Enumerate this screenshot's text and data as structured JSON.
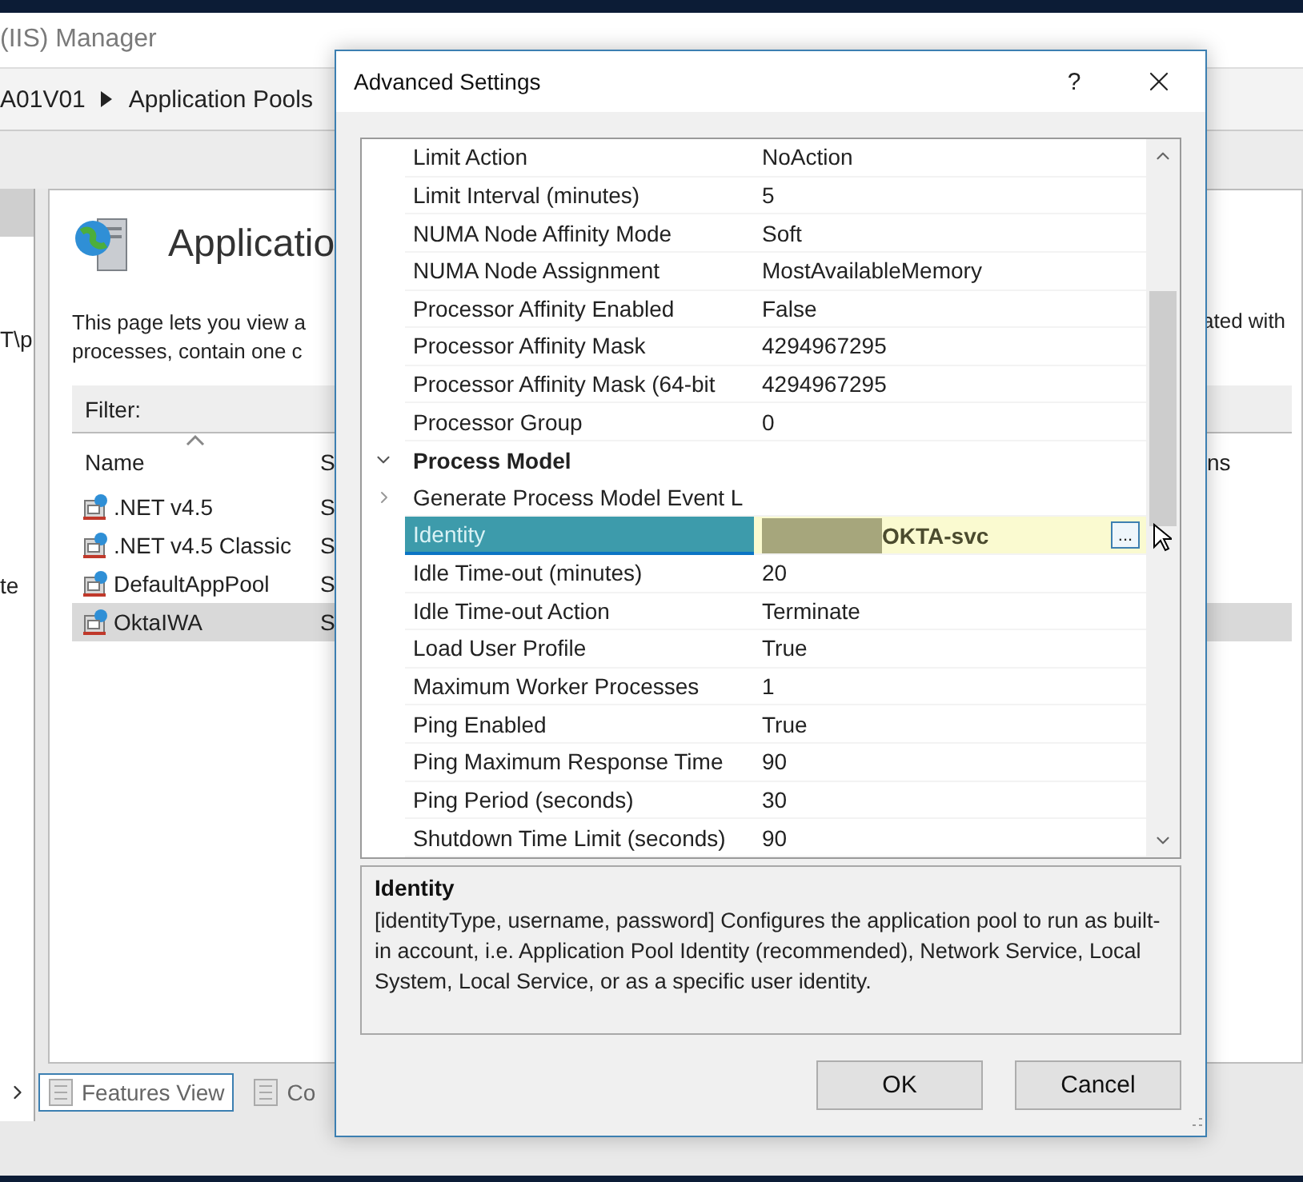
{
  "window": {
    "title": "(IIS) Manager"
  },
  "breadcrumb": [
    "A01V01",
    "Application Pools"
  ],
  "side_panel": {
    "texts": [
      "T\\p",
      "te"
    ]
  },
  "page": {
    "heading": "Applicatio",
    "description": [
      "This page lets you view a",
      "processes, contain one c"
    ],
    "description_right": "ated with",
    "filter_label": "Filter:",
    "columns": [
      "Name",
      "S",
      "ns"
    ],
    "pools": [
      {
        "name": ".NET v4.5",
        "column_2": "S",
        "selected": false
      },
      {
        "name": ".NET v4.5 Classic",
        "column_2": "S",
        "selected": false
      },
      {
        "name": "DefaultAppPool",
        "column_2": "S",
        "selected": false
      },
      {
        "name": "OktaIWA",
        "column_2": "S",
        "selected": true
      }
    ]
  },
  "view_tabs": [
    {
      "label": "Features View",
      "selected": true
    },
    {
      "label": "Co",
      "selected": false
    }
  ],
  "dialog": {
    "title": "Advanced Settings",
    "help": "?",
    "rows": [
      {
        "kind": "property",
        "name": "Limit Action",
        "value": "NoAction",
        "selected": false,
        "redacted": false
      },
      {
        "kind": "property",
        "name": "Limit Interval (minutes)",
        "value": "5",
        "selected": false,
        "redacted": false
      },
      {
        "kind": "property",
        "name": "NUMA Node Affinity Mode",
        "value": "Soft",
        "selected": false,
        "redacted": false
      },
      {
        "kind": "property",
        "name": "NUMA Node Assignment",
        "value": "MostAvailableMemory",
        "selected": false,
        "redacted": false
      },
      {
        "kind": "property",
        "name": "Processor Affinity Enabled",
        "value": "False",
        "selected": false,
        "redacted": false
      },
      {
        "kind": "property",
        "name": "Processor Affinity Mask",
        "value": "4294967295",
        "selected": false,
        "redacted": false
      },
      {
        "kind": "property",
        "name": "Processor Affinity Mask (64-bit",
        "value": "4294967295",
        "selected": false,
        "redacted": false
      },
      {
        "kind": "property",
        "name": "Processor Group",
        "value": "0",
        "selected": false,
        "redacted": false
      },
      {
        "kind": "category",
        "name": "Process Model",
        "expanded": true
      },
      {
        "kind": "property",
        "name": "Generate Process Model Event L",
        "selected": false,
        "redacted": false,
        "expanded": false
      },
      {
        "kind": "property",
        "name": "Identity",
        "value": "OKTA-svc",
        "selected": true,
        "redacted": true,
        "button": "..."
      },
      {
        "kind": "property",
        "name": "Idle Time-out (minutes)",
        "value": "20",
        "selected": false,
        "redacted": false
      },
      {
        "kind": "property",
        "name": "Idle Time-out Action",
        "value": "Terminate",
        "selected": false,
        "redacted": false
      },
      {
        "kind": "property",
        "name": "Load User Profile",
        "value": "True",
        "selected": false,
        "redacted": false
      },
      {
        "kind": "property",
        "name": "Maximum Worker Processes",
        "value": "1",
        "selected": false,
        "redacted": false
      },
      {
        "kind": "property",
        "name": "Ping Enabled",
        "value": "True",
        "selected": false,
        "redacted": false
      },
      {
        "kind": "property",
        "name": "Ping Maximum Response Time",
        "value": "90",
        "selected": false,
        "redacted": false
      },
      {
        "kind": "property",
        "name": "Ping Period (seconds)",
        "value": "30",
        "selected": false,
        "redacted": false
      },
      {
        "kind": "property",
        "name": "Shutdown Time Limit (seconds)",
        "value": "90",
        "selected": false,
        "redacted": false
      }
    ],
    "description": {
      "title": "Identity",
      "text": "[identityType, username, password] Configures the application pool to run as built-in account, i.e. Application Pool Identity (recommended), Network Service, Local System, Local Service, or as a specific user identity."
    },
    "buttons": [
      "OK",
      "Cancel"
    ]
  }
}
